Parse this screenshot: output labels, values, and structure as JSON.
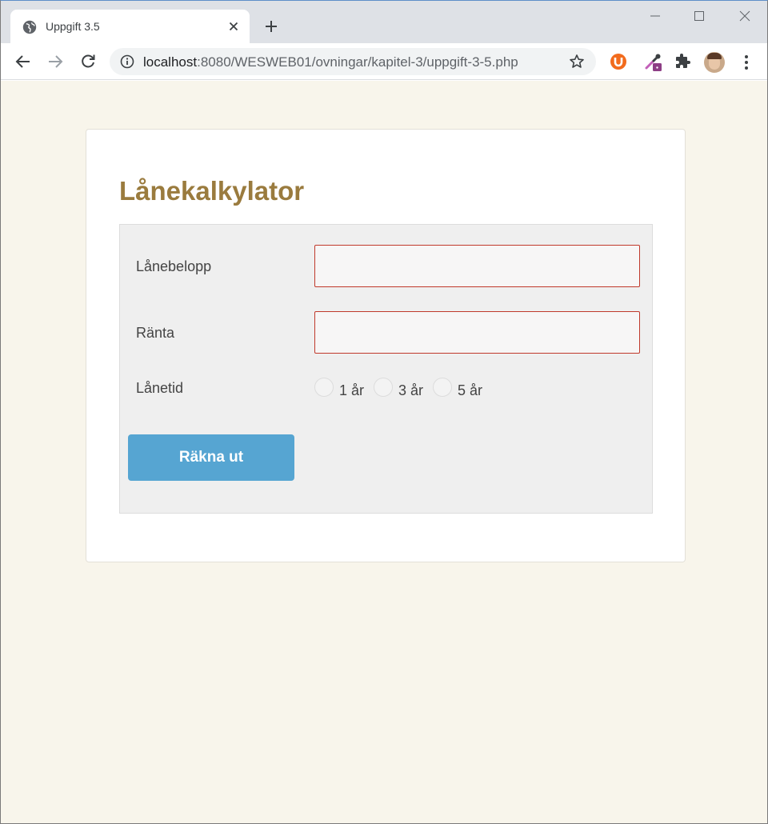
{
  "browser": {
    "tab_title": "Uppgift 3.5",
    "url_host": "localhost",
    "url_path": ":8080/WESWEB01/ovningar/kapitel-3/uppgift-3-5.php"
  },
  "page": {
    "heading": "Lånekalkylator",
    "fields": {
      "amount_label": "Lånebelopp",
      "amount_value": "",
      "rate_label": "Ränta",
      "rate_value": ""
    },
    "term": {
      "label": "Lånetid",
      "options": [
        "1 år",
        "3 år",
        "5 år"
      ]
    },
    "submit_label": "Räkna ut"
  },
  "colors": {
    "heading": "#9a7b3e",
    "button": "#56a5d2",
    "field_border": "#c0392b",
    "page_background": "#f8f5eb"
  },
  "icons": {
    "favicon": "globe-icon",
    "tab_close": "close-icon",
    "new_tab": "plus-icon",
    "back": "back-arrow-icon",
    "forward": "forward-arrow-icon",
    "reload": "reload-icon",
    "site_info": "info-icon",
    "bookmark": "star-icon",
    "extension_1": "ublock-icon",
    "extension_2": "eyedropper-icon",
    "extensions": "puzzle-icon",
    "menu": "kebab-menu-icon"
  }
}
